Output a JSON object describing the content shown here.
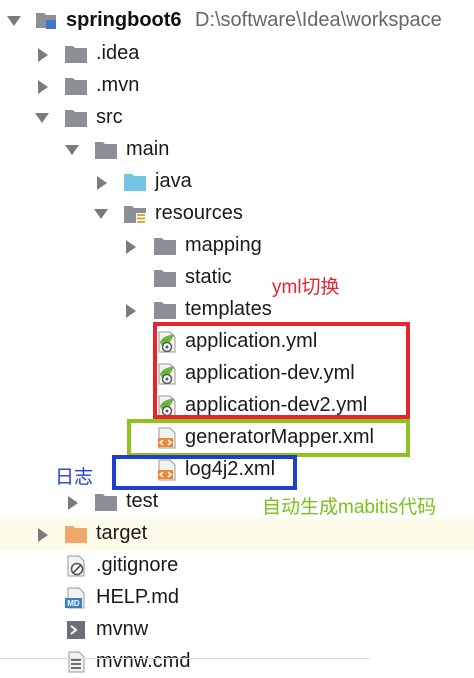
{
  "project": {
    "name": "springboot6",
    "path": "D:\\software\\Idea\\workspace"
  },
  "items": {
    "idea": ".idea",
    "mvn": ".mvn",
    "src": "src",
    "main": "main",
    "java": "java",
    "resources": "resources",
    "mapping": "mapping",
    "static": "static",
    "templates": "templates",
    "app_yml": "application.yml",
    "app_dev_yml": "application-dev.yml",
    "app_dev2_yml": "application-dev2.yml",
    "generator_xml": "generatorMapper.xml",
    "log4j2_xml": "log4j2.xml",
    "test": "test",
    "target": "target",
    "gitignore": ".gitignore",
    "help_md": "HELP.md",
    "mvnw": "mvnw",
    "mvnw_cmd": "mvnw.cmd"
  },
  "annotations": {
    "yml_switch": "yml切换",
    "log": "日志",
    "mybatis_gen": "自动生成mabitis代码"
  },
  "icons": {
    "folder": "folder-icon",
    "source_folder": "source-folder-icon",
    "resources_folder": "resources-folder-icon",
    "excluded_folder": "excluded-folder-icon",
    "yml_file": "spring-config-icon",
    "xml_file": "xml-file-icon",
    "markdown": "markdown-icon",
    "terminal": "terminal-icon",
    "text_file": "text-file-icon",
    "gitignore_file": "gitignore-icon",
    "module": "module-icon"
  },
  "colors": {
    "folder": "#8b9097",
    "source_folder": "#73c5e6",
    "excluded_folder": "#f0a86a",
    "red_box": "#e8252b",
    "green_box": "#8ec31c",
    "blue_box": "#1f3fd1",
    "red_text": "#e8252b",
    "green_text": "#7bc21b",
    "blue_text": "#1f3fd1",
    "highlight_row": "#fdfbea"
  }
}
